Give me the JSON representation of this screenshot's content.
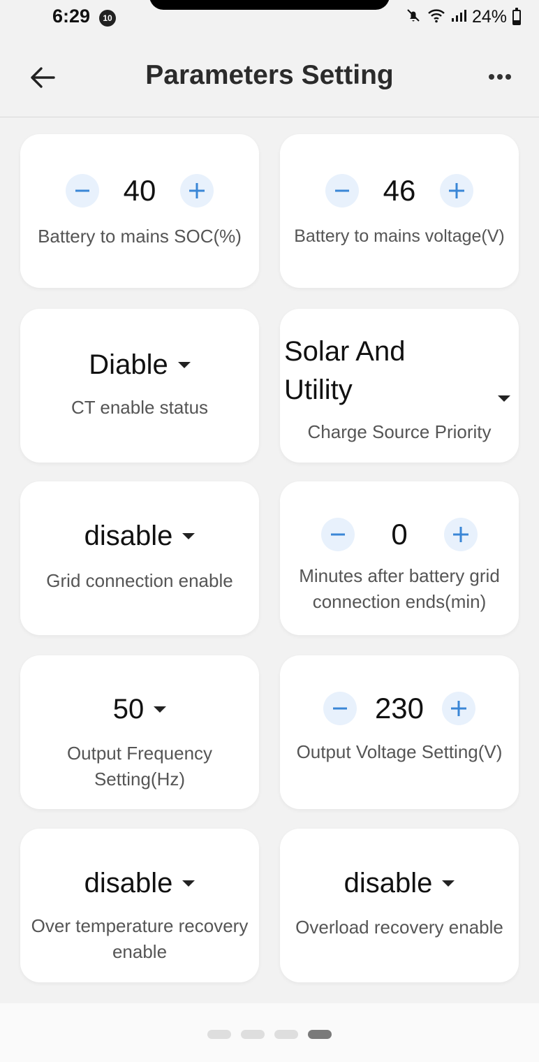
{
  "status_bar": {
    "time": "6:29",
    "notification_count": "10",
    "battery_percent": "24%",
    "icons": [
      "mute-icon",
      "wifi-icon",
      "signal-icon",
      "battery-icon"
    ]
  },
  "header": {
    "title": "Parameters Setting",
    "back_icon": "arrow-left-icon",
    "more_icon": "more-horizontal-icon"
  },
  "params": {
    "battery_to_mains_soc": {
      "value": "40",
      "label": "Battery to mains SOC(%)"
    },
    "battery_to_mains_voltage": {
      "value": "46",
      "label": "Battery to mains voltage(V)"
    },
    "ct_enable_status": {
      "value": "Diable",
      "label": "CT enable status"
    },
    "charge_source_priority": {
      "value": "Solar And Utility",
      "label": "Charge Source Priority"
    },
    "grid_connection_enable": {
      "value": "disable",
      "label": "Grid connection enable"
    },
    "minutes_after_battery_grid": {
      "value": "0",
      "label": "Minutes after battery grid connection ends(min)"
    },
    "output_frequency": {
      "value": "50",
      "label": "Output Frequency Setting(Hz)"
    },
    "output_voltage": {
      "value": "230",
      "label": "Output Voltage Setting(V)"
    },
    "over_temperature_recovery": {
      "value": "disable",
      "label": "Over temperature recovery enable"
    },
    "overload_recovery": {
      "value": "disable",
      "label": "Overload recovery enable"
    }
  },
  "pagination": {
    "pages": 4,
    "current": 4
  },
  "colors": {
    "accent": "#3a86d6",
    "stepper_bg": "#e8f1fc",
    "background": "#f2f2f2",
    "card": "#ffffff"
  }
}
